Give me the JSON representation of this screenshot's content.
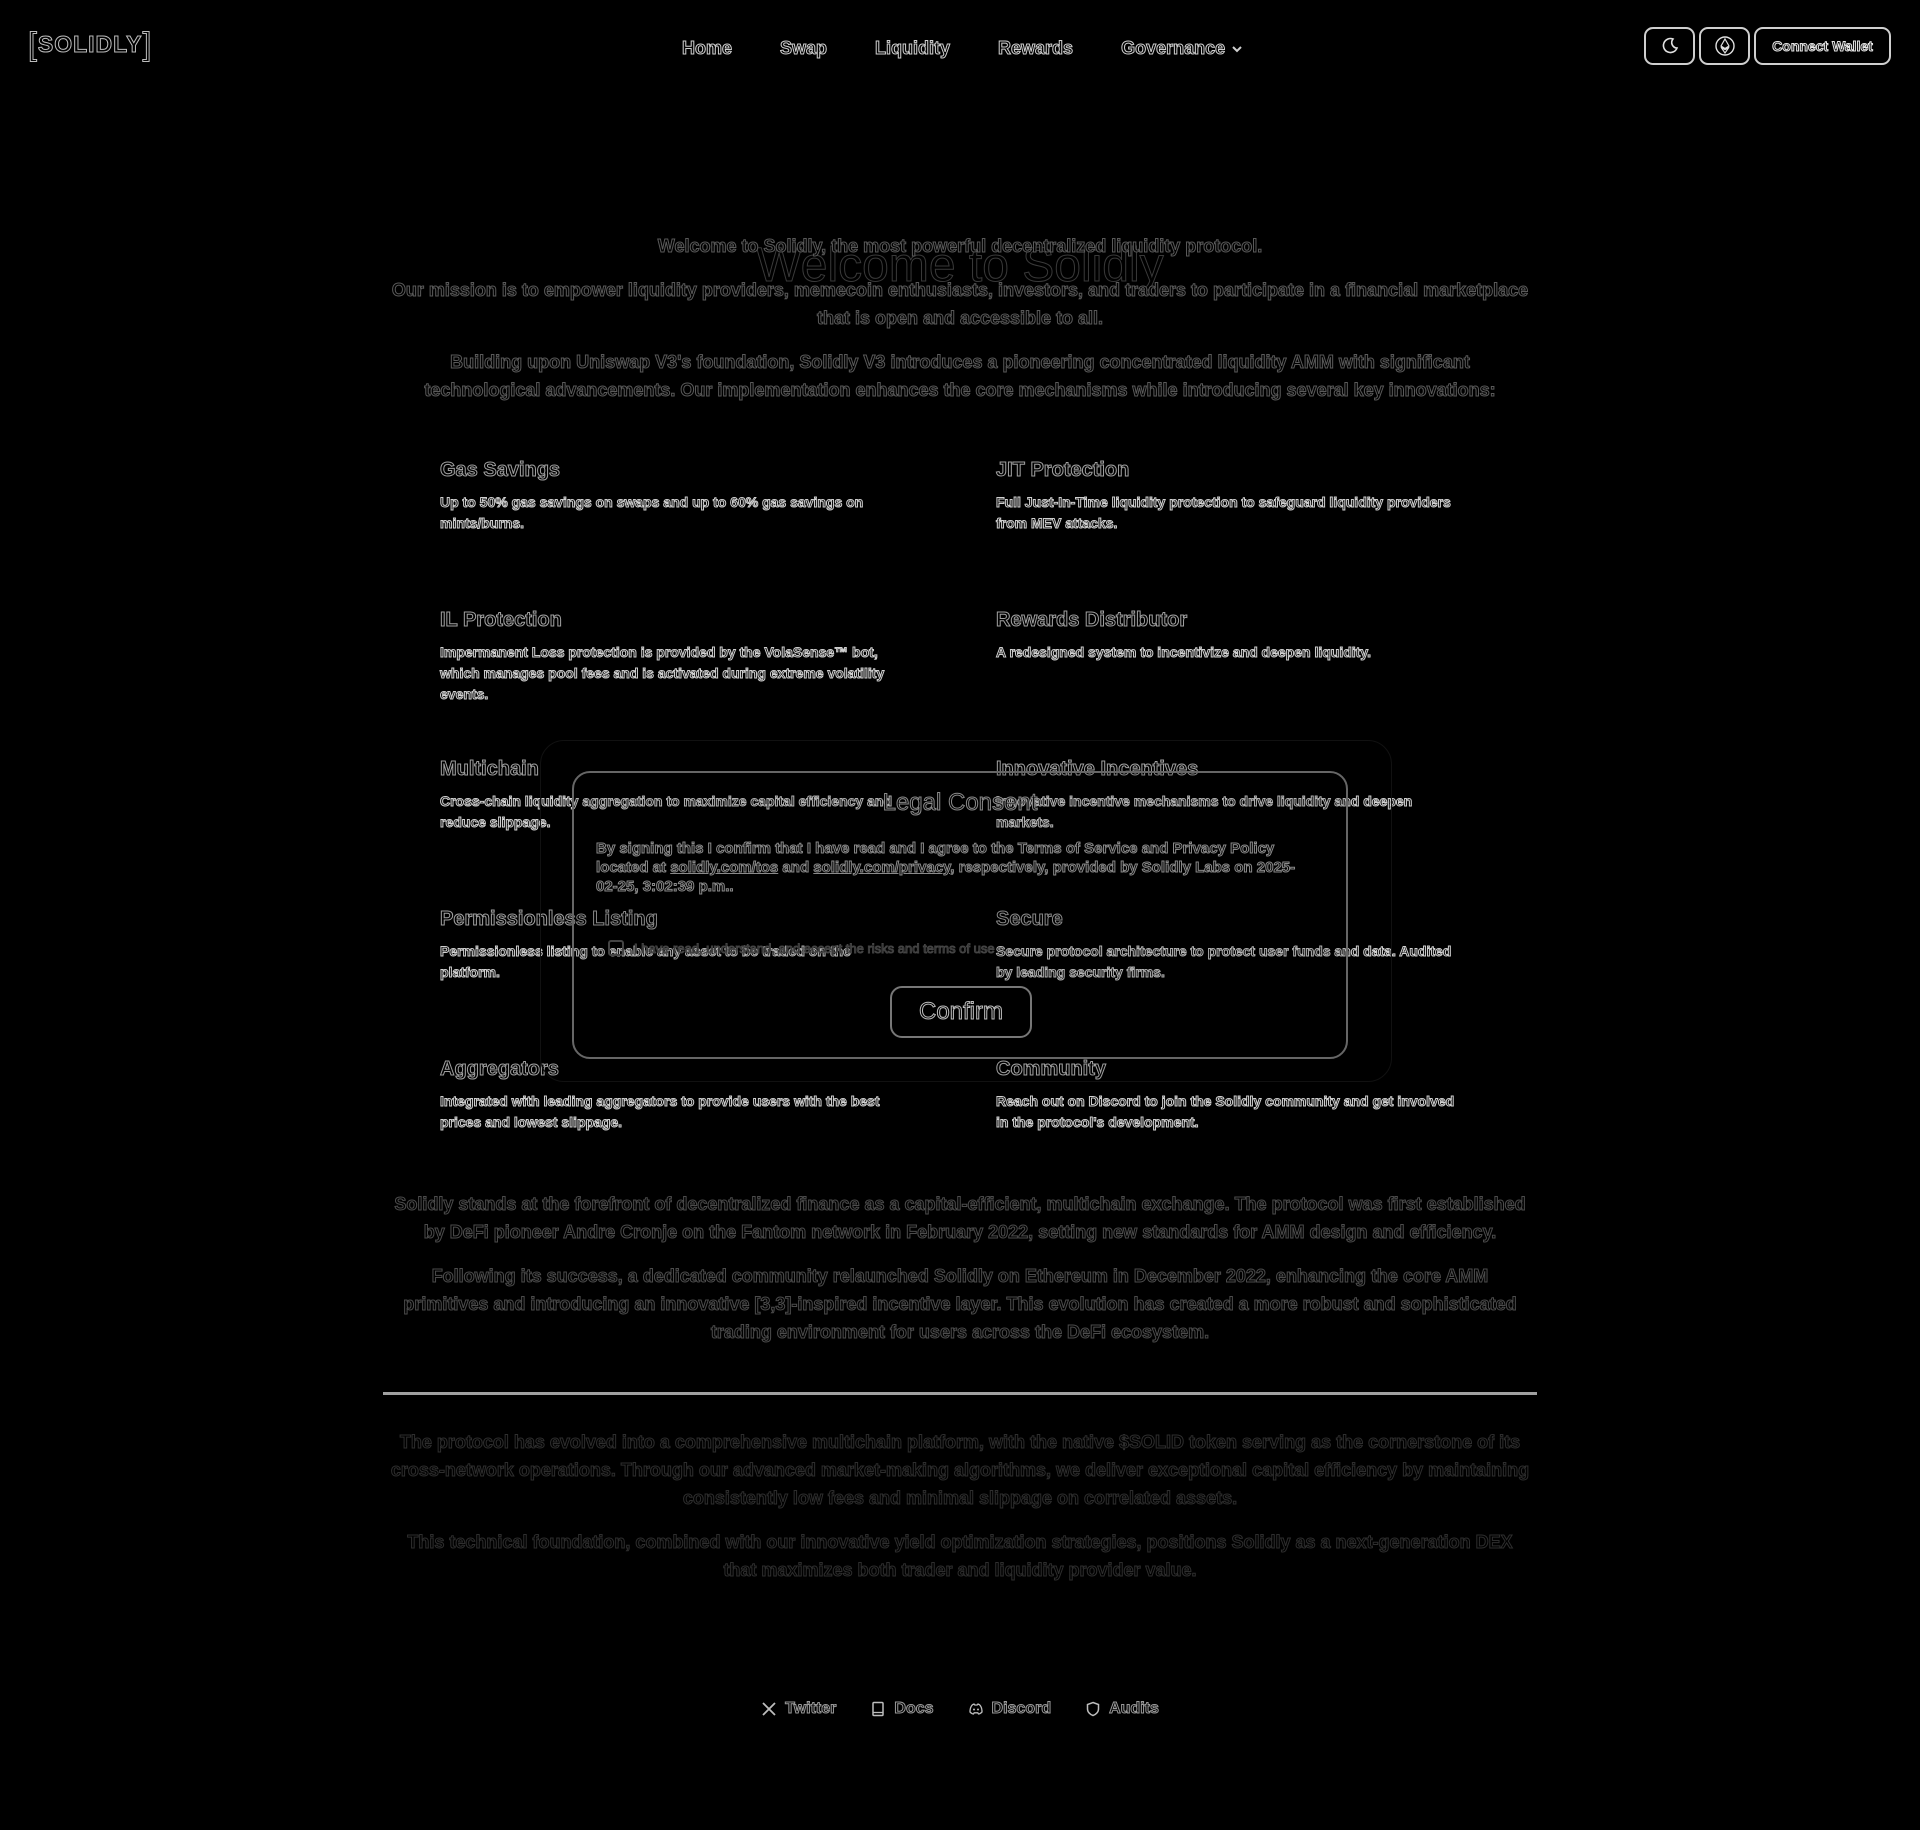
{
  "header": {
    "logo": "SOLIDLY",
    "nav": [
      "Home",
      "Swap",
      "Liquidity",
      "Rewards",
      "Governance"
    ],
    "connect_label": "Connect Wallet"
  },
  "hero": {
    "title": "Welcome to Solidly",
    "subtitle": "Welcome to Solidly, the most powerful decentralized liquidity protocol.",
    "p1": "Our mission is to empower liquidity providers, memecoin enthusiasts, investors, and traders to participate in a financial marketplace that is open and accessible to all.",
    "p2": "Building upon Uniswap V3's foundation, Solidly V3 introduces a pioneering concentrated liquidity AMM with significant technological advancements. Our implementation enhances the core mechanisms while introducing several key innovations:"
  },
  "features": [
    {
      "title": "Gas Savings",
      "text": "Up to 50% gas savings on swaps and up to 60% gas savings on mints/burns."
    },
    {
      "title": "JIT Protection",
      "text": "Full Just-In-Time liquidity protection to safeguard liquidity providers from MEV attacks."
    },
    {
      "title": "IL Protection",
      "text": "Impermanent Loss protection is provided by the VolaSense™ bot, which manages pool fees and is activated during extreme volatility events."
    },
    {
      "title": "Rewards Distributor",
      "text": "A redesigned system to incentivize and deepen liquidity."
    },
    {
      "title": "Multichain",
      "text": "Cross-chain liquidity aggregation to maximize capital efficiency and reduce slippage."
    },
    {
      "title": "Innovative Incentives",
      "text": "Innovative incentive mechanisms to drive liquidity and deepen markets."
    },
    {
      "title": "Permissionless Listing",
      "text": "Permissionless listing to enable any asset to be traded on the platform."
    },
    {
      "title": "Secure",
      "text": "Secure protocol architecture to protect user funds and data. Audited by leading security firms."
    },
    {
      "title": "Aggregators",
      "text": "Integrated with leading aggregators to provide users with the best prices and lowest slippage."
    },
    {
      "title": "Community",
      "text": "Reach out on Discord to join the Solidly community and get involved in the protocol's development."
    }
  ],
  "lower": {
    "p3": "Solidly stands at the forefront of decentralized finance as a capital-efficient, multichain exchange. The protocol was first established by DeFi pioneer Andre Cronje on the Fantom network in February 2022, setting new standards for AMM design and efficiency.",
    "p4": "Following its success, a dedicated community relaunched Solidly on Ethereum in December 2022, enhancing the core AMM primitives and introducing an innovative [3,3]-inspired incentive layer. This evolution has created a more robust and sophisticated trading environment for users across the DeFi ecosystem.",
    "p5": "The protocol has evolved into a comprehensive multichain platform, with the native $SOLID token serving as the cornerstone of its cross-network operations. Through our advanced market-making algorithms, we deliver exceptional capital efficiency by maintaining consistently low fees and minimal slippage on correlated assets.",
    "p6": "This technical foundation, combined with our innovative yield optimization strategies, positions Solidly as a next-generation DEX that maximizes both trader and liquidity provider value."
  },
  "footer": [
    "Twitter",
    "Docs",
    "Discord",
    "Audits"
  ],
  "modal": {
    "title": "Legal Consent",
    "text_a": "By signing this I confirm that I have read and I agree to the Terms of Service and Privacy Policy located at ",
    "link1": "solidly.com/tos",
    "text_b": " and ",
    "link2": "solidly.com/privacy",
    "text_c": ", respectively, provided by Solidly Labs on 2025-02-25, 3:02:39 p.m..",
    "checkbox_label": "I have read, understand, and accept the risks and terms of use",
    "confirm_label": "Confirm"
  }
}
